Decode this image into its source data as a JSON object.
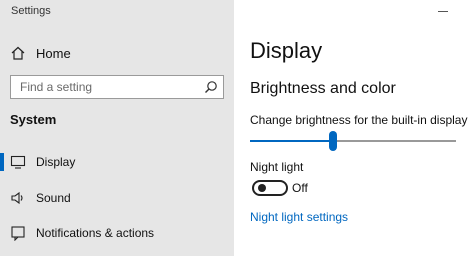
{
  "window": {
    "title": "Settings"
  },
  "sidebar": {
    "home_label": "Home",
    "search_placeholder": "Find a setting",
    "section_label": "System",
    "items": [
      {
        "label": "Display",
        "icon": "monitor-icon",
        "active": true
      },
      {
        "label": "Sound",
        "icon": "speaker-icon",
        "active": false
      },
      {
        "label": "Notifications & actions",
        "icon": "notification-icon",
        "active": false
      }
    ]
  },
  "main": {
    "page_title": "Display",
    "group_title": "Brightness and color",
    "brightness": {
      "label": "Change brightness for the built-in display",
      "value_fraction": 0.4
    },
    "night_light": {
      "label": "Night light",
      "state_label": "Off",
      "on": false
    },
    "night_light_settings_link": "Night light settings"
  },
  "colors": {
    "sidebar_bg": "#e6e6e6",
    "accent": "#0067c0",
    "text": "#111111"
  }
}
